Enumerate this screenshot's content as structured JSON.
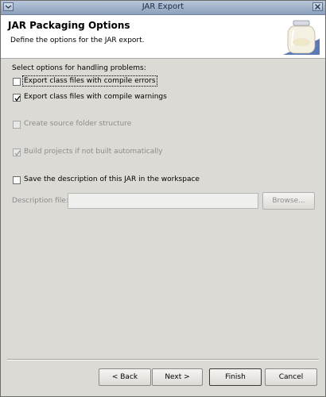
{
  "window": {
    "title": "JAR Export"
  },
  "header": {
    "title": "JAR Packaging Options",
    "description": "Define the options for the JAR export.",
    "wizard_icon": "jar-icon"
  },
  "problems": {
    "section_label": "Select options for handling problems:",
    "export_errors": {
      "label": "Export class files with compile errors",
      "checked": false,
      "enabled": true
    },
    "export_warnings": {
      "label": "Export class files with compile warnings",
      "checked": true,
      "enabled": true
    }
  },
  "create_source_folder": {
    "label": "Create source folder structure",
    "checked": false,
    "enabled": false
  },
  "build_projects": {
    "label": "Build projects if not built automatically",
    "checked": true,
    "enabled": false
  },
  "save_description": {
    "label": "Save the description of this JAR in the workspace",
    "checked": false,
    "enabled": true
  },
  "description_file": {
    "label": "Description file:",
    "value": "",
    "browse_label": "Browse..."
  },
  "buttons": {
    "back": "< Back",
    "next": "Next >",
    "finish": "Finish",
    "cancel": "Cancel"
  }
}
